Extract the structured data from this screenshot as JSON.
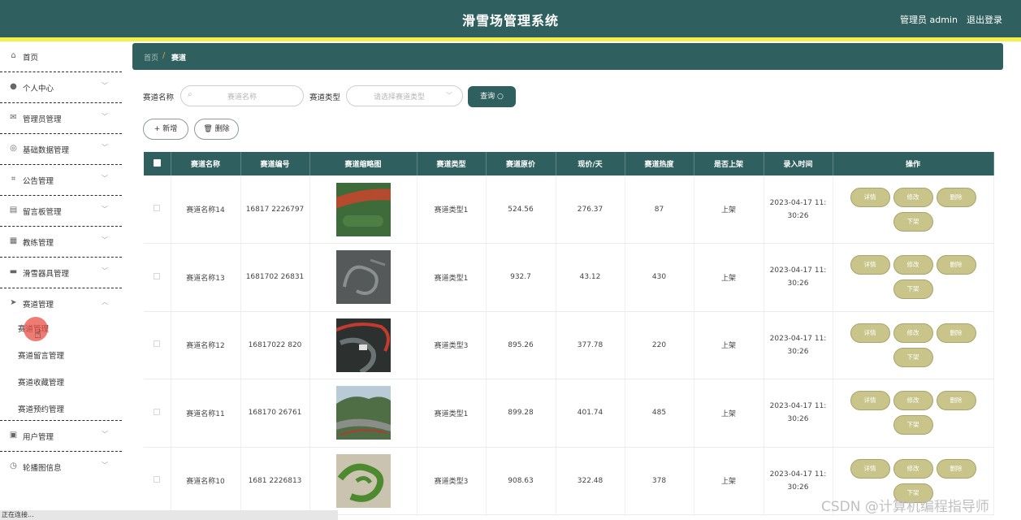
{
  "header": {
    "title": "滑雪场管理系统",
    "user": "管理员 admin",
    "logout": "退出登录"
  },
  "sidebar": {
    "items": [
      {
        "label": "首页",
        "icon": "home-icon",
        "glyph": "⌂"
      },
      {
        "label": "个人中心",
        "icon": "user-icon",
        "glyph": "●"
      },
      {
        "label": "管理员管理",
        "icon": "mail-icon",
        "glyph": "✉"
      },
      {
        "label": "基础数据管理",
        "icon": "compass-icon",
        "glyph": "◎"
      },
      {
        "label": "公告管理",
        "icon": "crop-icon",
        "glyph": "⌗"
      },
      {
        "label": "留言板管理",
        "icon": "shop-icon",
        "glyph": "▤"
      },
      {
        "label": "教练管理",
        "icon": "film-icon",
        "glyph": "▦"
      },
      {
        "label": "滑雪器具管理",
        "icon": "printer-icon",
        "glyph": "▬"
      },
      {
        "label": "赛道管理",
        "icon": "send-icon",
        "glyph": "➤"
      },
      {
        "label": "用户管理",
        "icon": "document-icon",
        "glyph": "▣"
      },
      {
        "label": "轮播图信息",
        "icon": "clock-icon",
        "glyph": "◷"
      }
    ],
    "subitems": [
      {
        "label": "赛道管理"
      },
      {
        "label": "赛道留言管理"
      },
      {
        "label": "赛道收藏管理"
      },
      {
        "label": "赛道预约管理"
      }
    ]
  },
  "breadcrumb": {
    "home": "首页",
    "separator": "/",
    "current": "赛道"
  },
  "search": {
    "name_label": "赛道名称",
    "name_placeholder": "赛道名称",
    "type_label": "赛道类型",
    "type_placeholder": "请选择赛道类型",
    "query_button": "查询 ○"
  },
  "actions": {
    "add": "+ 新增",
    "delete": "🗑 删除"
  },
  "table": {
    "headers": [
      "赛道名称",
      "赛道编号",
      "赛道缩略图",
      "赛道类型",
      "赛道原价",
      "现价/天",
      "赛道热度",
      "是否上架",
      "录入时间",
      "操作"
    ],
    "rows": [
      {
        "name": "赛道名称14",
        "code": "16817 2226797",
        "type": "赛道类型1",
        "price": "524.56",
        "now": "276.37",
        "heat": "87",
        "status": "上架",
        "time1": "2023-04-17 11:",
        "time2": "30:26"
      },
      {
        "name": "赛道名称13",
        "code": "1681702 26831",
        "type": "赛道类型1",
        "price": "932.7",
        "now": "43.12",
        "heat": "430",
        "status": "上架",
        "time1": "2023-04-17 11:",
        "time2": "30:26"
      },
      {
        "name": "赛道名称12",
        "code": "16817022 820",
        "type": "赛道类型3",
        "price": "895.26",
        "now": "377.78",
        "heat": "220",
        "status": "上架",
        "time1": "2023-04-17 11:",
        "time2": "30:26"
      },
      {
        "name": "赛道名称11",
        "code": "168170 26761",
        "type": "赛道类型1",
        "price": "899.28",
        "now": "401.74",
        "heat": "485",
        "status": "上架",
        "time1": "2023-04-17 11:",
        "time2": "30:26"
      },
      {
        "name": "赛道名称10",
        "code": "1681 2226813",
        "type": "赛道类型3",
        "price": "908.63",
        "now": "322.48",
        "heat": "378",
        "status": "上架",
        "time1": "2023-04-17 11:",
        "time2": "30:26"
      }
    ],
    "ops": {
      "detail": "详情",
      "edit": "修改",
      "delete": "删除",
      "offshelf": "下架"
    }
  },
  "status_bar": "正在连接...",
  "watermark": "CSDN @计算机编程指导师",
  "colors": {
    "primary": "#2f5f5e",
    "accent_bar": "#f2f04a",
    "op_button": "#c8c48a",
    "click_marker": "#e85046"
  }
}
